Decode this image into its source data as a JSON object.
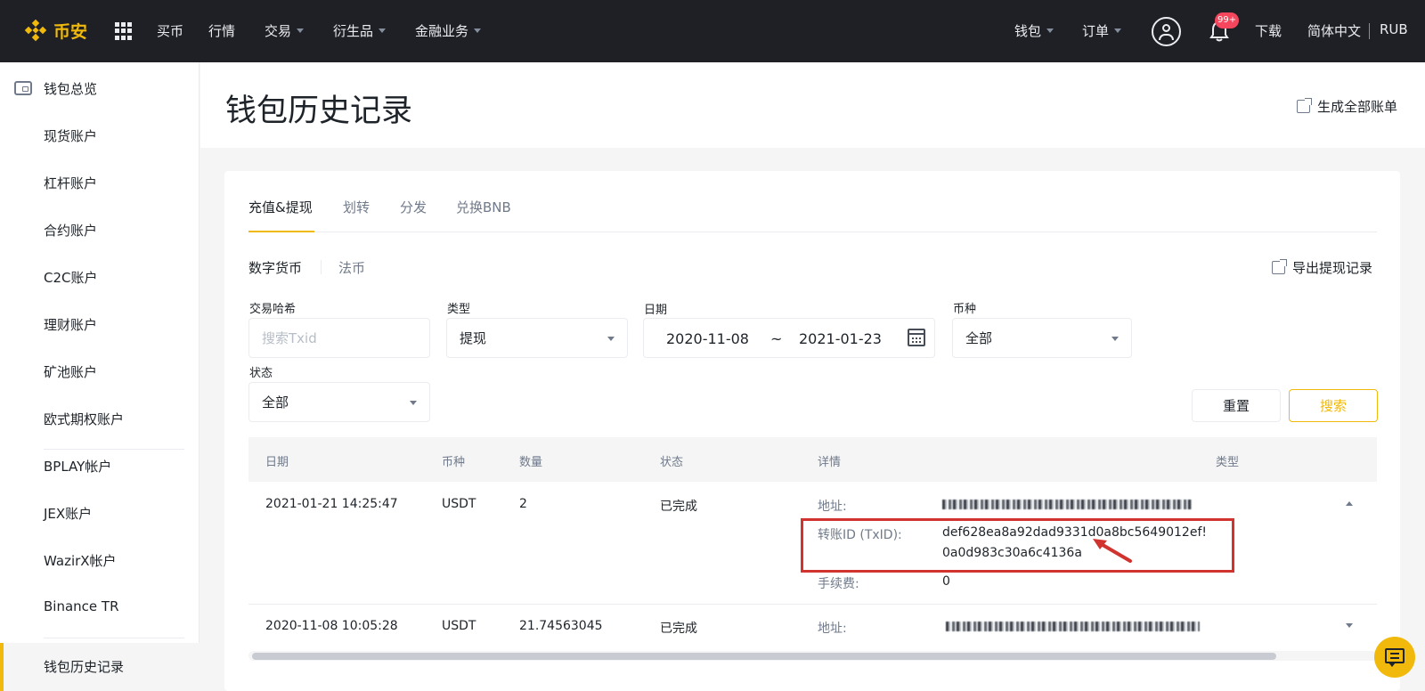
{
  "colors": {
    "brand": "#f0b90b",
    "nav_bg": "#1e2026",
    "highlight": "#d1342f",
    "badge": "#f6465d"
  },
  "topnav": {
    "logo_text": "币安",
    "items": [
      {
        "label": "买币"
      },
      {
        "label": "行情"
      },
      {
        "label": "交易"
      },
      {
        "label": "衍生品"
      },
      {
        "label": "金融业务"
      }
    ],
    "right": {
      "wallet": "钱包",
      "orders": "订单",
      "notification_badge": "99+",
      "download": "下载",
      "language": "简体中文",
      "currency": "RUB"
    }
  },
  "sidebar": {
    "items": [
      {
        "label": "钱包总览"
      },
      {
        "label": "现货账户"
      },
      {
        "label": "杠杆账户"
      },
      {
        "label": "合约账户"
      },
      {
        "label": "C2C账户"
      },
      {
        "label": "理财账户"
      },
      {
        "label": "矿池账户"
      },
      {
        "label": "欧式期权账户"
      },
      {
        "label": "BPLAY帐户"
      },
      {
        "label": "JEX账户"
      },
      {
        "label": "WazirX帐户"
      },
      {
        "label": "Binance TR"
      },
      {
        "label": "钱包历史记录"
      }
    ]
  },
  "header": {
    "title": "钱包历史记录",
    "generate_bill": "生成全部账单"
  },
  "tabs": [
    {
      "label": "充值&提现"
    },
    {
      "label": "划转"
    },
    {
      "label": "分发"
    },
    {
      "label": "兑换BNB"
    }
  ],
  "subtabs": [
    {
      "label": "数字货币"
    },
    {
      "label": "法币"
    }
  ],
  "export_withdraw": "导出提现记录",
  "filters": {
    "txhash": {
      "label": "交易哈希",
      "placeholder": "搜索Txid"
    },
    "type": {
      "label": "类型",
      "value": "提现"
    },
    "date": {
      "label": "日期",
      "from": "2020-11-08",
      "sep": "~",
      "to": "2021-01-23"
    },
    "coin": {
      "label": "币种",
      "value": "全部"
    },
    "status": {
      "label": "状态",
      "value": "全部"
    }
  },
  "buttons": {
    "reset": "重置",
    "search": "搜索"
  },
  "table": {
    "headers": {
      "date": "日期",
      "coin": "币种",
      "amount": "数量",
      "status": "状态",
      "details": "详情",
      "type": "类型"
    },
    "rows": [
      {
        "date": "2021-01-21 14:25:47",
        "coin": "USDT",
        "amount": "2",
        "status": "已完成",
        "address_label": "地址:",
        "txid_label": "转账ID (TxID):",
        "txid_line1": "def628ea8a92dad9331d0a8bc5649012ef!",
        "txid_line2": "0a0d983c30a6c4136a",
        "fee_label": "手续费:",
        "fee": "0"
      },
      {
        "date": "2020-11-08 10:05:28",
        "coin": "USDT",
        "amount": "21.74563045",
        "status": "已完成",
        "address_label": "地址:"
      }
    ]
  }
}
